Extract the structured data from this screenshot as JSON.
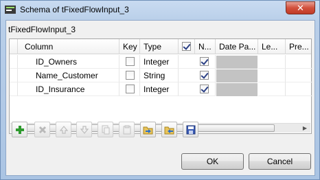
{
  "window": {
    "title": "Schema of tFixedFlowInput_3",
    "close_glyph": "✕"
  },
  "component_label": "tFixedFlowInput_3",
  "table": {
    "columns": [
      "Column",
      "Key",
      "Type",
      "",
      "N...",
      "Date Pa...",
      "Le...",
      "Pre..."
    ],
    "header_nullable_checked": true,
    "rows": [
      {
        "column": "ID_Owners",
        "key": false,
        "type": "Integer",
        "nullable": true
      },
      {
        "column": "Name_Customer",
        "key": false,
        "type": "String",
        "nullable": true
      },
      {
        "column": "ID_Insurance",
        "key": false,
        "type": "Integer",
        "nullable": true
      }
    ],
    "scroll_grip": "|||"
  },
  "toolbar": {
    "buttons": [
      {
        "name": "add-icon",
        "enabled": true
      },
      {
        "name": "remove-icon",
        "enabled": false
      },
      {
        "name": "move-up-icon",
        "enabled": false
      },
      {
        "name": "move-down-icon",
        "enabled": false
      },
      {
        "name": "copy-icon",
        "enabled": false
      },
      {
        "name": "paste-icon",
        "enabled": false
      },
      {
        "name": "import-icon",
        "enabled": true
      },
      {
        "name": "export-icon",
        "enabled": true
      },
      {
        "name": "save-icon",
        "enabled": true
      }
    ]
  },
  "buttons": {
    "ok": "OK",
    "cancel": "Cancel"
  },
  "colors": {
    "accent_blue": "#2a3f84",
    "add_green": "#2f9a2f",
    "window_frame": "#aac4e3"
  }
}
